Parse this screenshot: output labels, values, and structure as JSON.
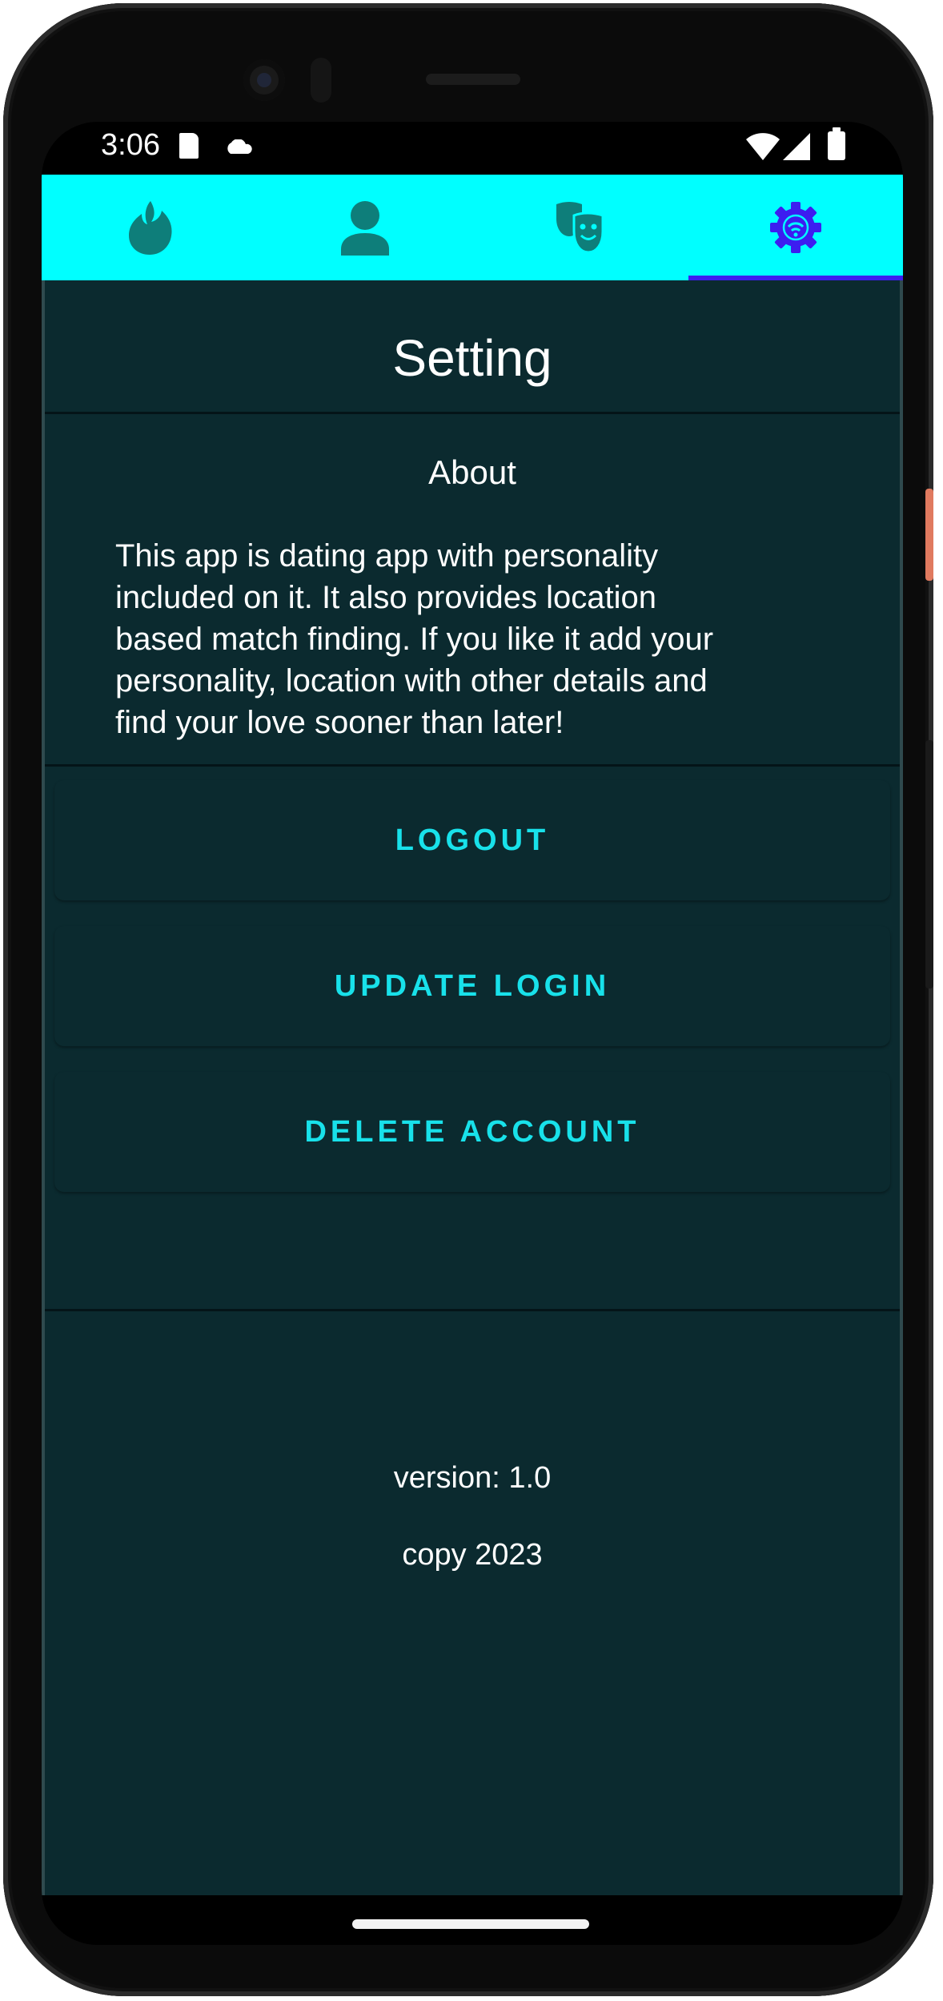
{
  "status_bar": {
    "time": "3:06",
    "icons": [
      "sd-card-icon",
      "cloud-icon",
      "wifi-icon",
      "signal-icon",
      "battery-icon"
    ]
  },
  "tabs": [
    {
      "icon": "flame-icon",
      "selected": false
    },
    {
      "icon": "person-icon",
      "selected": false
    },
    {
      "icon": "theater-masks-icon",
      "selected": false
    },
    {
      "icon": "settings-gear-icon",
      "selected": true
    }
  ],
  "colors": {
    "tab_bar_bg": "#00ffff",
    "tab_icon": "#0e7e7a",
    "tab_selected_icon": "#3d1df0",
    "content_bg": "#0b2a2f",
    "button_text": "#18e1ea"
  },
  "page": {
    "title": "Setting",
    "about_title": "About",
    "about_text": "This app is dating app with personality\nincluded on it. It also provides location\nbased match finding. If you like it add your\npersonality, location  with other details and\nfind your love sooner than later!"
  },
  "buttons": {
    "logout": "LOGOUT",
    "update_login": "UPDATE LOGIN",
    "delete_account": "DELETE ACCOUNT"
  },
  "footer": {
    "version": "version: 1.0",
    "copy": "copy 2023"
  }
}
